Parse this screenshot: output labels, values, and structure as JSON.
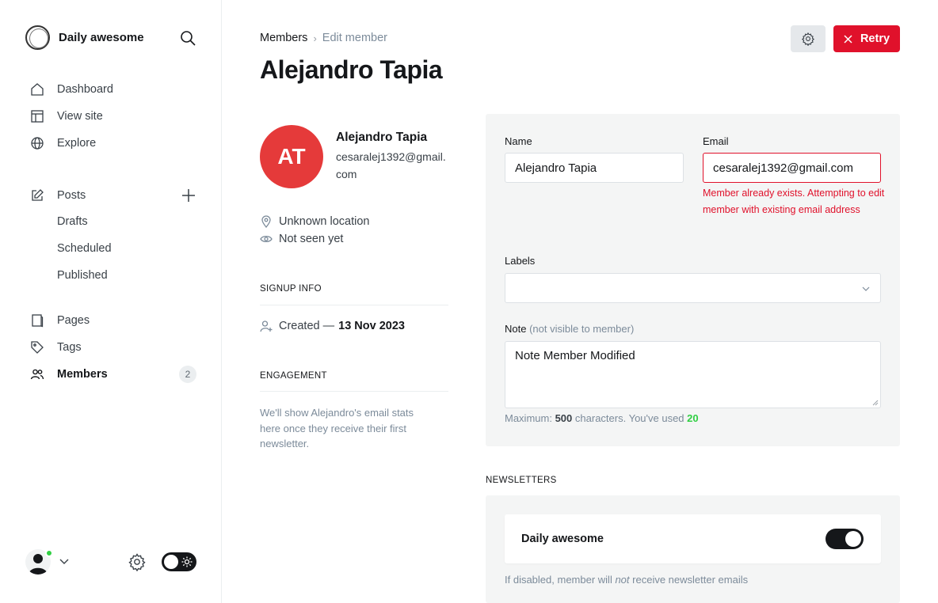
{
  "sidebar": {
    "brand": "Daily awesome",
    "nav": {
      "dashboard": "Dashboard",
      "view_site": "View site",
      "explore": "Explore",
      "posts": "Posts",
      "drafts": "Drafts",
      "scheduled": "Scheduled",
      "published": "Published",
      "pages": "Pages",
      "tags": "Tags",
      "members": "Members",
      "members_count": "2"
    }
  },
  "header": {
    "breadcrumb_parent": "Members",
    "breadcrumb_separator": "›",
    "breadcrumb_current": "Edit member",
    "title": "Alejandro Tapia",
    "retry_label": "Retry"
  },
  "member": {
    "initials": "AT",
    "name": "Alejandro Tapia",
    "email": "cesaralej1392@gmail.com",
    "location": "Unknown location",
    "last_seen": "Not seen yet",
    "signup_label": "SIGNUP INFO",
    "created_prefix": "Created —",
    "created_date": "13 Nov 2023",
    "engagement_label": "ENGAGEMENT",
    "engagement_text": "We'll show Alejandro's email stats here once they receive their first newsletter."
  },
  "form": {
    "name_label": "Name",
    "name_value": "Alejandro Tapia",
    "email_label": "Email",
    "email_value": "cesaralej1392@gmail.com",
    "email_error": "Member already exists. Attempting to edit member with existing email address",
    "labels_label": "Labels",
    "note_label": "Note",
    "note_hint": "(not visible to member)",
    "note_value": "Note Member Modified",
    "char_prefix": "Maximum:",
    "char_max": "500",
    "char_mid": "characters. You've used",
    "char_used": "20"
  },
  "newsletters": {
    "section_label": "NEWSLETTERS",
    "name": "Daily awesome",
    "subscribed": true,
    "hint_before": "If disabled, member will",
    "hint_em": "not",
    "hint_after": "receive newsletter emails"
  },
  "colors": {
    "accent_red": "#e0112b",
    "avatar_red": "#e53a3a",
    "success_green": "#30cf43"
  }
}
